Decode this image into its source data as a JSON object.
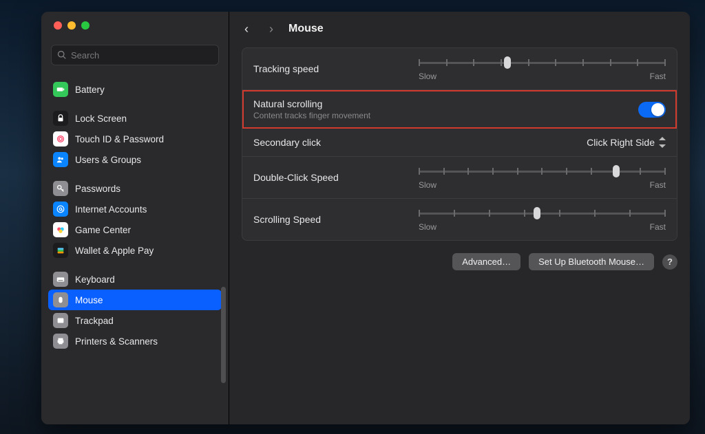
{
  "header": {
    "title": "Mouse"
  },
  "search": {
    "placeholder": "Search"
  },
  "sidebar": {
    "items": [
      {
        "label": "Battery",
        "icon": "battery",
        "bg": "#34c759"
      },
      {
        "label": "Lock Screen",
        "icon": "lock",
        "bg": "#1c1c1e"
      },
      {
        "label": "Touch ID & Password",
        "icon": "touchid",
        "bg": "#ffffff"
      },
      {
        "label": "Users & Groups",
        "icon": "users",
        "bg": "#0a84ff"
      },
      {
        "label": "Passwords",
        "icon": "key",
        "bg": "#8e8e93"
      },
      {
        "label": "Internet Accounts",
        "icon": "at",
        "bg": "#0a84ff"
      },
      {
        "label": "Game Center",
        "icon": "gamecenter",
        "bg": "#ffffff"
      },
      {
        "label": "Wallet & Apple Pay",
        "icon": "wallet",
        "bg": "#1c1c1e"
      },
      {
        "label": "Keyboard",
        "icon": "keyboard",
        "bg": "#8e8e93"
      },
      {
        "label": "Mouse",
        "icon": "mouse",
        "bg": "#8e8e93",
        "selected": true
      },
      {
        "label": "Trackpad",
        "icon": "trackpad",
        "bg": "#8e8e93"
      },
      {
        "label": "Printers & Scanners",
        "icon": "printer",
        "bg": "#8e8e93"
      }
    ]
  },
  "settings": {
    "tracking": {
      "label": "Tracking speed",
      "min_label": "Slow",
      "max_label": "Fast",
      "ticks": 10,
      "value_pct": 36
    },
    "natural": {
      "label": "Natural scrolling",
      "sub": "Content tracks finger movement",
      "enabled": true
    },
    "secondary": {
      "label": "Secondary click",
      "value": "Click Right Side"
    },
    "dblclick": {
      "label": "Double-Click Speed",
      "min_label": "Slow",
      "max_label": "Fast",
      "ticks": 11,
      "value_pct": 80
    },
    "scrolling": {
      "label": "Scrolling Speed",
      "min_label": "Slow",
      "max_label": "Fast",
      "ticks": 8,
      "value_pct": 48
    }
  },
  "footer": {
    "advanced": "Advanced…",
    "bluetooth": "Set Up Bluetooth Mouse…",
    "help": "?"
  }
}
